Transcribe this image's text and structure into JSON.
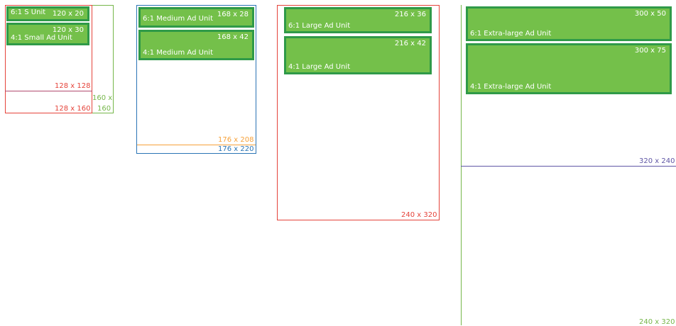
{
  "units": [
    {
      "ratio_label": "6:1 S Unit",
      "size_label": "120 x 20"
    },
    {
      "ratio_label": "4:1 Small Ad Unit",
      "size_label": "120 x 30"
    },
    {
      "ratio_label": "6:1 Medium Ad Unit",
      "size_label": "168 x 28"
    },
    {
      "ratio_label": "4:1 Medium Ad Unit",
      "size_label": "168 x 42"
    },
    {
      "ratio_label": "6:1 Large Ad Unit",
      "size_label": "216 x 36"
    },
    {
      "ratio_label": "4:1 Large Ad Unit",
      "size_label": "216 x 42"
    },
    {
      "ratio_label": "6:1 Extra-large Ad Unit",
      "size_label": "300 x 50"
    },
    {
      "ratio_label": "4:1 Extra-large Ad Unit",
      "size_label": "300 x 75"
    }
  ],
  "screens": [
    {
      "label": "128 x 128",
      "color": "#e5433a"
    },
    {
      "label": "128 x 160",
      "color": "#e5433a"
    },
    {
      "label_line1": "160 x",
      "label_line2": "160",
      "color": "#75b649"
    },
    {
      "label": "176 x 208",
      "color": "#f6a13a"
    },
    {
      "label": "176 x 220",
      "color": "#2a74b5"
    },
    {
      "label": "240 x 320",
      "color": "#e5433a"
    },
    {
      "label": "320 x 240",
      "color": "#5f56a5"
    },
    {
      "label": "240 x 320",
      "color": "#75b649"
    }
  ],
  "colors": {
    "ad_fill": "#74c04a",
    "ad_border": "#2f9a48",
    "ad_text": "#ffffff"
  }
}
